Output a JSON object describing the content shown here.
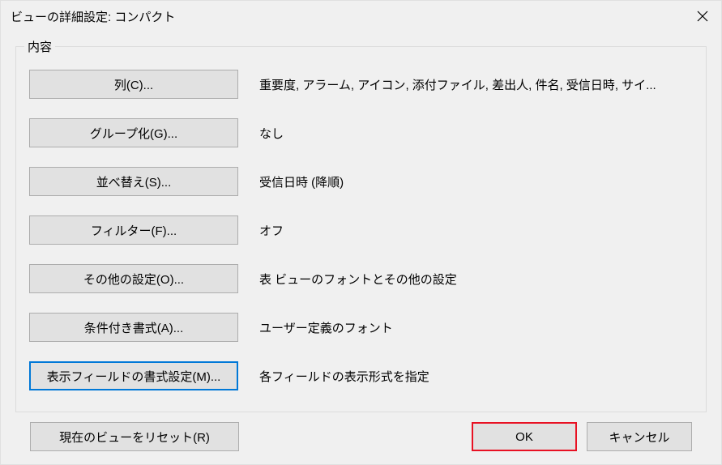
{
  "title": "ビューの詳細設定: コンパクト",
  "groupbox_label": "内容",
  "rows": [
    {
      "label": "列(C)...",
      "desc": "重要度, アラーム, アイコン, 添付ファイル, 差出人, 件名, 受信日時, サイ..."
    },
    {
      "label": "グループ化(G)...",
      "desc": "なし"
    },
    {
      "label": "並べ替え(S)...",
      "desc": "受信日時 (降順)"
    },
    {
      "label": "フィルター(F)...",
      "desc": "オフ"
    },
    {
      "label": "その他の設定(O)...",
      "desc": "表 ビューのフォントとその他の設定"
    },
    {
      "label": "条件付き書式(A)...",
      "desc": "ユーザー定義のフォント"
    },
    {
      "label": "表示フィールドの書式設定(M)...",
      "desc": "各フィールドの表示形式を指定"
    }
  ],
  "reset_label": "現在のビューをリセット(R)",
  "ok_label": "OK",
  "cancel_label": "キャンセル"
}
